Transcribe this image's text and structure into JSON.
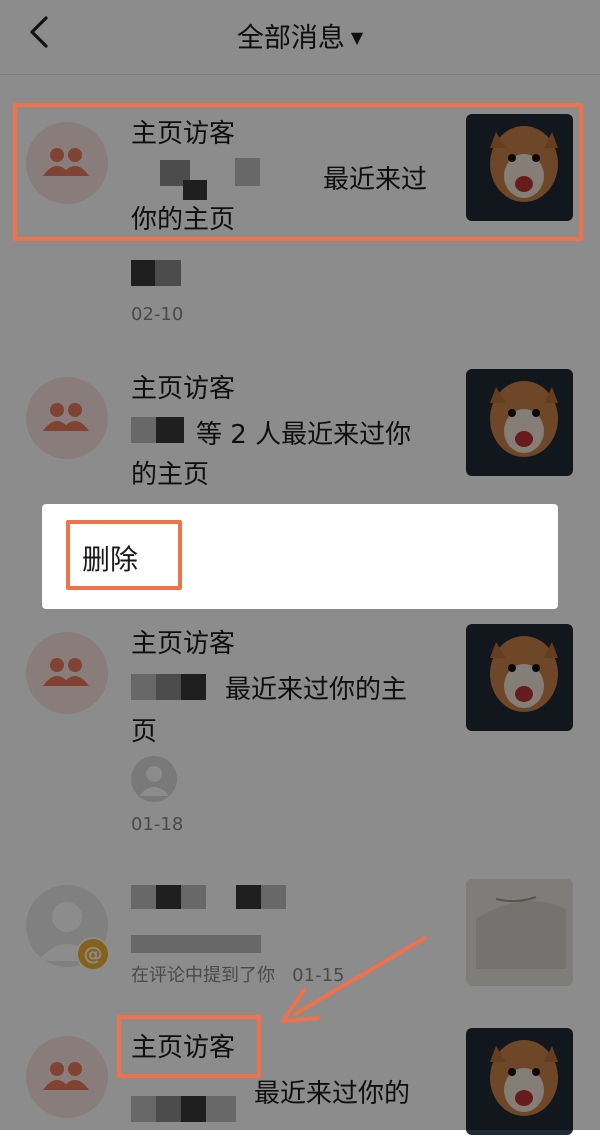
{
  "header": {
    "title": "全部消息",
    "caret": "▼"
  },
  "items": [
    {
      "title": "主页访客",
      "line1_suffix": "最近来过",
      "line2": "你的主页",
      "date": "02-10"
    },
    {
      "title": "主页访客",
      "line1_suffix": "等 2 人最近来过你",
      "line2": "的主页"
    },
    {
      "title": "主页访客",
      "line1_suffix": "最近来过你的主",
      "line2": "页",
      "date": "01-18"
    },
    {
      "subtitle": "在评论中提到了你",
      "date": "01-15",
      "badge": "@"
    },
    {
      "title": "主页访客",
      "line1_suffix": "最近来过你的"
    }
  ],
  "popup": {
    "delete_label": "删除"
  },
  "colors": {
    "highlight": "#f0714a",
    "group_icon": "#e97a5d",
    "badge": "#f2b333"
  }
}
